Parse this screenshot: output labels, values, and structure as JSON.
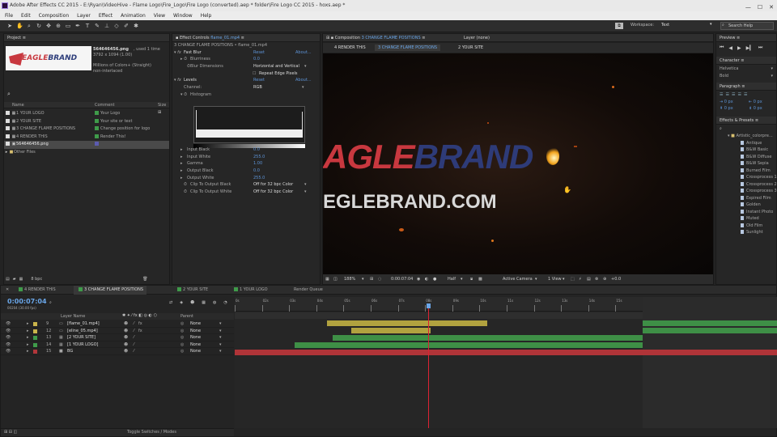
{
  "window": {
    "title": "Adobe After Effects CC 2015 - E:\\Ryan\\VideoHive - Flame Logo\\Fire_Logo\\Fire Logo (converted).aep * folder\\Fire Logo CC 2015 - hoxs.aep *"
  },
  "menu": [
    "File",
    "Edit",
    "Composition",
    "Layer",
    "Effect",
    "Animation",
    "View",
    "Window",
    "Help"
  ],
  "toolbar": {
    "workspace_label": "Workspace:",
    "workspace_value": "Text",
    "search_placeholder": "Search Help"
  },
  "project": {
    "title": "Project",
    "thumb_name": "564646456.png",
    "thumb_used": ", used 1 time",
    "thumb_size": "3792 x 1094 (1.00)",
    "thumb_colors": "Millions of Colors+ (Straight)",
    "thumb_interlace": "non-interlaced",
    "col_name": "Name",
    "col_comment": "Comment",
    "col_size": "Size",
    "items": [
      {
        "name": "1 YOUR LOGO",
        "comment": "Your Logo"
      },
      {
        "name": "2 YOUR SITE",
        "comment": "Your site or text"
      },
      {
        "name": "3 CHANGE FLAME POSITIONS",
        "comment": "Change position for logo"
      },
      {
        "name": "4 RENDER THIS",
        "comment": "Render This!"
      },
      {
        "name": "564646456.png",
        "comment": ""
      },
      {
        "name": "Other Files",
        "comment": ""
      }
    ],
    "bpc": "8 bpc"
  },
  "effects": {
    "title": "Effect Controls",
    "title_file": "flame_01.mp4",
    "subtitle": "3 CHANGE FLAME POSITIONS • flame_01.mp4",
    "fast_blur": "Fast Blur",
    "reset": "Reset",
    "about": "About...",
    "blurriness_k": "Blurriness",
    "blurriness_v": "0.0",
    "blur_dim_k": "Blur Dimensions",
    "blur_dim_v": "Horizontal and Vertical",
    "repeat_edge": "Repeat Edge Pixels",
    "levels": "Levels",
    "channel_k": "Channel:",
    "channel_v": "RGB",
    "histogram": "Histogram",
    "params": [
      {
        "k": "Input Black",
        "v": "0.0"
      },
      {
        "k": "Input White",
        "v": "255.0"
      },
      {
        "k": "Gamma",
        "v": "1.00"
      },
      {
        "k": "Output Black",
        "v": "0.0"
      },
      {
        "k": "Output White",
        "v": "255.0"
      },
      {
        "k": "Clip To Output Black",
        "v": "Off for 32 bpc Color"
      },
      {
        "k": "Clip To Output White",
        "v": "Off for 32 bpc Color"
      }
    ]
  },
  "viewer": {
    "title": "Composition",
    "title_comp": "3 CHANGE FLAME POSITIONS",
    "layer_tab": "Layer (none)",
    "crumbs": [
      "4 RENDER THIS",
      "3 CHANGE FLAME POSITIONS",
      "2 YOUR SITE"
    ],
    "logo_a": "AGLE",
    "logo_b": "BRAND",
    "site": "EGLEBRAND.COM",
    "zoom": "188%",
    "time": "0:00:07:04",
    "res": "Half",
    "camera": "Active Camera",
    "views": "1 View",
    "plus": "+0.0"
  },
  "right": {
    "preview": "Preview",
    "character": "Character",
    "font": "Helvetica",
    "style": "Bold",
    "paragraph": "Paragraph",
    "px1": "0 px",
    "px2": "0 px",
    "px3": "0 px",
    "px4": "0 px",
    "effects_presets": "Effects & Presets",
    "preset_folder": "Artistic_colorpre...",
    "presets": [
      "Antique",
      "B&W Basic",
      "B&W Diffuse",
      "B&W Sepia",
      "Burned Film",
      "Crossprocess 1",
      "Crossprocess 2",
      "Crossprocess 3",
      "Expired Film",
      "Golden",
      "Instant Photo",
      "Muted",
      "Old Film",
      "Sunlight"
    ]
  },
  "timeline": {
    "tabs": [
      "4 RENDER THIS",
      "3 CHANGE FLAME POSITIONS",
      "2 YOUR SITE",
      "1 YOUR LOGO",
      "Render Queue"
    ],
    "timecode": "0:00:07:04",
    "frames": "00204 (30.00 fps)",
    "col_layer": "Layer Name",
    "col_parent": "Parent",
    "layers": [
      {
        "num": "9",
        "name": "[flame_01.mp4]",
        "parent": "None",
        "color": "#c9b44b"
      },
      {
        "num": "12",
        "name": "[eline_05.mp4]",
        "parent": "None",
        "color": "#c9b44b"
      },
      {
        "num": "13",
        "name": "[2 YOUR SITE]",
        "parent": "None",
        "color": "#3f9b4a"
      },
      {
        "num": "14",
        "name": "[1 YOUR LOGO]",
        "parent": "None",
        "color": "#3f9b4a"
      },
      {
        "num": "15",
        "name": "BG",
        "parent": "None",
        "color": "#b2363a"
      }
    ],
    "ruler": [
      "0s",
      "02s",
      "03s",
      "04s",
      "05s",
      "06s",
      "07s",
      "08s",
      "09s",
      "10s",
      "11s",
      "12s",
      "13s",
      "14s",
      "15s"
    ],
    "toggle": "Toggle Switches / Modes",
    "playhead_time": 7.1,
    "duration": 15,
    "bars": [
      {
        "start": 3.4,
        "end": 9.3,
        "color": "#b1a23f"
      },
      {
        "start": 4.3,
        "end": 7.2,
        "color": "#b1a23f"
      },
      {
        "start": 3.6,
        "end": 15,
        "color": "#3e8f46"
      },
      {
        "start": 2.2,
        "end": 15,
        "color": "#3e8f46"
      },
      {
        "start": 0,
        "end": 15,
        "color": "#b03438"
      }
    ]
  },
  "colors": {
    "accent": "#6aa6e8",
    "red": "#c8383f",
    "orange": "#f2a31c"
  }
}
